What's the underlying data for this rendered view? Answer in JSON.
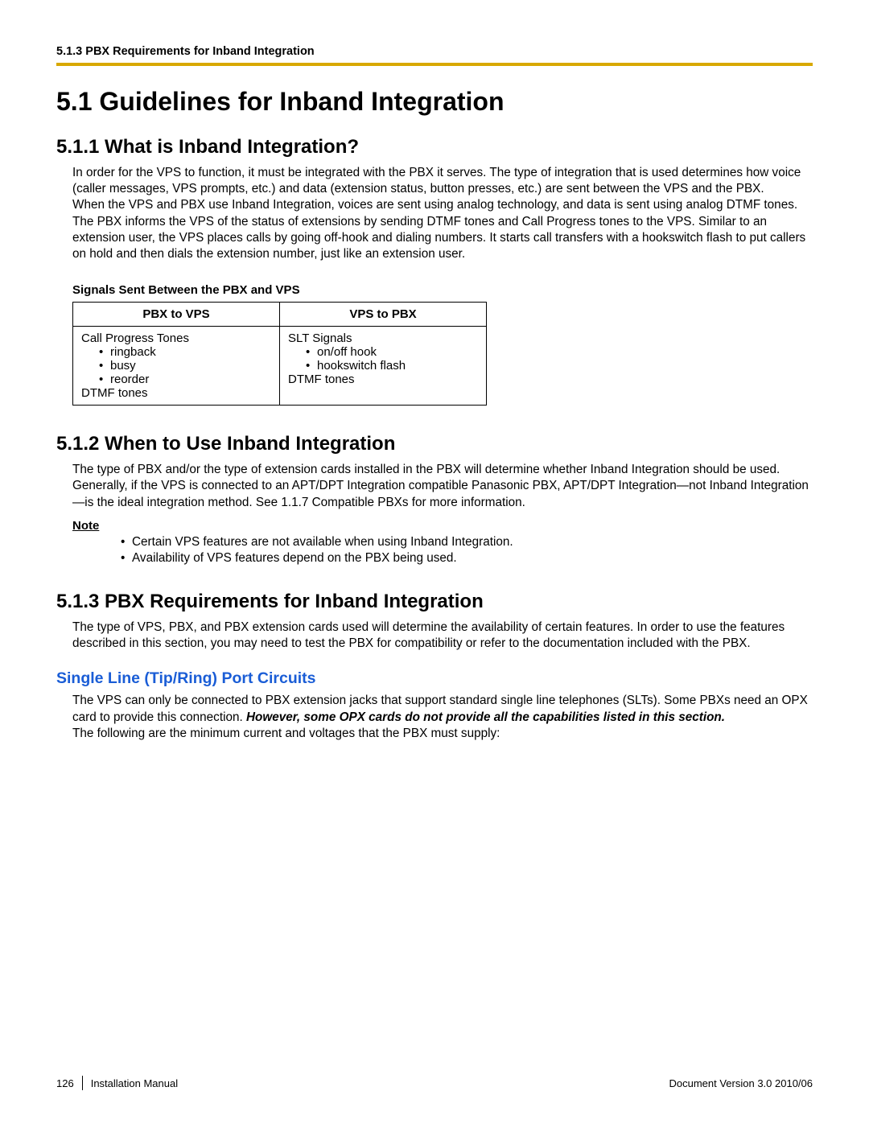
{
  "header_ref": "5.1.3 PBX Requirements for Inband Integration",
  "h1": "5.1  Guidelines for Inband Integration",
  "s511_h": "5.1.1  What is Inband Integration?",
  "s511_p1": "In order for the VPS to function, it must be integrated with the PBX it serves. The type of integration that is used determines how voice (caller messages, VPS prompts, etc.) and data (extension status, button presses, etc.) are sent between the VPS and the PBX.",
  "s511_p2": "When the VPS and PBX use Inband Integration, voices are sent using analog technology, and data is sent using analog DTMF tones.",
  "s511_p3": "The PBX informs the VPS of the status of extensions by sending DTMF tones and Call Progress tones to the VPS. Similar to an extension user, the VPS places calls by going off-hook and dialing numbers. It starts call transfers with a hookswitch flash to put callers on hold and then dials the extension number, just like an extension user.",
  "sig_head": "Signals Sent Between the PBX and VPS",
  "table": {
    "h1": "PBX to VPS",
    "h2": "VPS to PBX",
    "c1_line1": "Call Progress Tones",
    "c1_items": [
      "ringback",
      "busy",
      "reorder"
    ],
    "c1_line2": "DTMF tones",
    "c2_line1": "SLT Signals",
    "c2_items": [
      "on/off hook",
      "hookswitch flash"
    ],
    "c2_line2": "DTMF tones"
  },
  "s512_h": "5.1.2  When to Use Inband Integration",
  "s512_p": "The type of PBX and/or the type of extension cards installed in the PBX will determine whether Inband Integration should be used. Generally, if the VPS is connected to an APT/DPT Integration compatible Panasonic PBX, APT/DPT Integration—not Inband Integration—is the ideal integration method. See 1.1.7  Compatible PBXs for more information.",
  "note_label": "Note",
  "note_items": [
    "Certain VPS features are not available when using Inband Integration.",
    "Availability of VPS features depend on the PBX being used."
  ],
  "s513_h": "5.1.3  PBX Requirements for Inband Integration",
  "s513_p": "The type of VPS, PBX, and PBX extension cards used will determine the availability of certain features. In order to use the features described in this section, you may need to test the PBX for compatibility or refer to the documentation included with the PBX.",
  "blue_h": "Single Line (Tip/Ring) Port Circuits",
  "blue_p1a": "The VPS can only be connected to PBX extension jacks that support standard single line telephones (SLTs). Some PBXs need an OPX card to provide this connection. ",
  "blue_p1b_em": "However, some OPX cards do not provide all the capabilities listed in this section.",
  "blue_p2": "The following are the minimum current and voltages that the PBX must supply:",
  "footer": {
    "page": "126",
    "doc": "Installation Manual",
    "ver": "Document Version  3.0  2010/06"
  }
}
